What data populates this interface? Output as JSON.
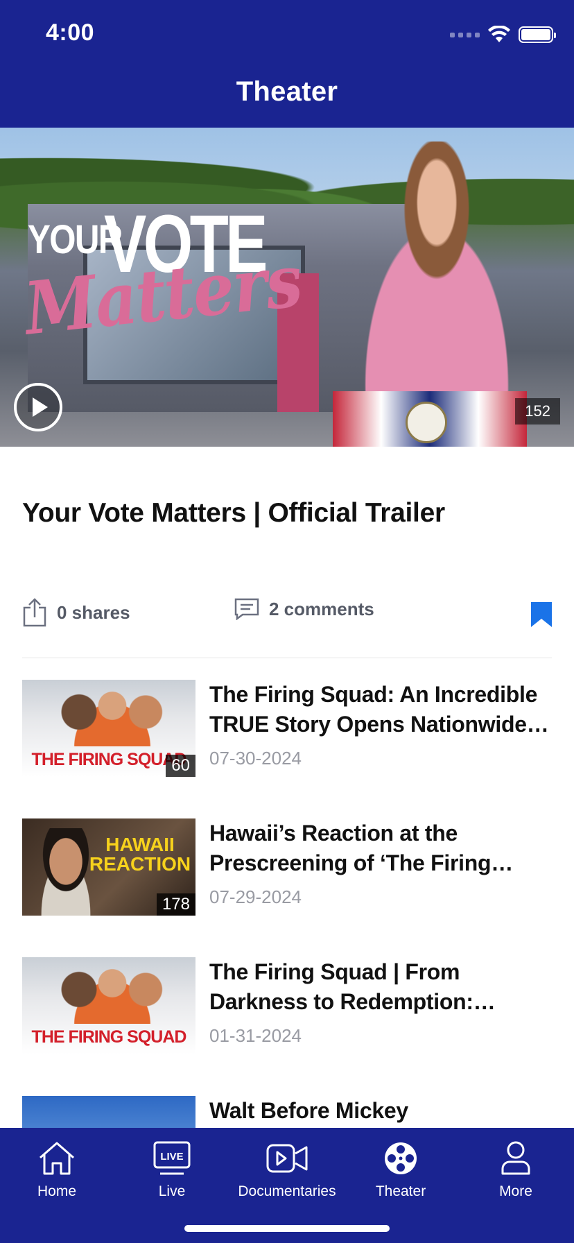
{
  "status_bar": {
    "time": "4:00"
  },
  "header": {
    "title": "Theater"
  },
  "hero": {
    "logo_your": "YOUR",
    "logo_vote": "VOTE",
    "logo_matters": "Matters",
    "count": "152"
  },
  "article": {
    "title": "Your Vote Matters | Official Trailer",
    "shares": "0 shares",
    "comments": "2 comments"
  },
  "list": [
    {
      "title": "The Firing Squad: An Incredible TRUE Story Opens Nationwide on…",
      "date": "07-30-2024",
      "count": "60",
      "thumb_text": "THE FIRING SQUAD"
    },
    {
      "title": "Hawaii’s Reaction at the Prescreening of ‘The Firing Squad’",
      "date": "07-29-2024",
      "count": "178",
      "thumb_text": "HAWAII REACTION"
    },
    {
      "title": "The Firing Squad | From Darkness to Redemption: Witness the Power of…",
      "date": "01-31-2024",
      "count": "",
      "thumb_text": "THE FIRING SQUAD"
    },
    {
      "title": "Walt Before Mickey",
      "date": "",
      "count": "",
      "thumb_text": ""
    }
  ],
  "nav": {
    "home": "Home",
    "live": "Live",
    "live_badge": "LIVE",
    "documentaries": "Documentaries",
    "theater": "Theater",
    "more": "More"
  },
  "colors": {
    "brand": "#1a2491",
    "bookmark": "#1a73e8",
    "date": "#999ba3"
  },
  "icons": [
    "wifi-icon",
    "battery-icon",
    "play-icon",
    "share-icon",
    "comment-icon",
    "bookmark-icon",
    "home-icon",
    "live-icon",
    "video-camera-icon",
    "film-reel-icon",
    "person-icon"
  ]
}
